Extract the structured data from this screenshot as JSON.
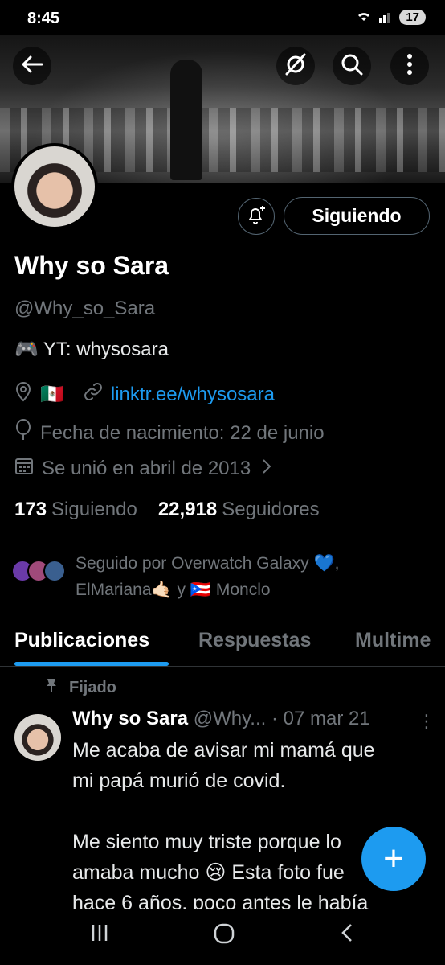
{
  "status": {
    "time": "8:45",
    "battery": "17"
  },
  "profile": {
    "follow_label": "Siguiendo",
    "name": "Why so Sara",
    "handle": "@Why_so_Sara",
    "bio_emoji": "🎮",
    "bio": "YT: whysosara",
    "flag": "🇲🇽",
    "link": "linktr.ee/whysosara",
    "birthday": "Fecha de nacimiento: 22 de junio",
    "joined": "Se unió en abril de 2013"
  },
  "stats": {
    "following_count": "173",
    "following_label": "Siguiendo",
    "followers_count": "22,918",
    "followers_label": "Seguidores"
  },
  "followed_by": {
    "line1": "Seguido por Overwatch Galaxy 💙,",
    "line2": "ElMariana🤙🏻 y 🇵🇷 Monclo"
  },
  "tabs": [
    {
      "label": "Publicaciones"
    },
    {
      "label": "Respuestas"
    },
    {
      "label": "Multime"
    }
  ],
  "pinned_label": "Fijado",
  "post": {
    "author": "Why so Sara",
    "handle": "@Why...",
    "date": "· 07 mar 21",
    "more": "⋮",
    "text": "Me acaba de avisar mi mamá que\nmi papá murió de covid.\n\nMe siento muy triste porque lo\namaba mucho 😢 Esta foto fue\nhace 6 años, poco antes le había"
  },
  "fab_label": "+",
  "colors": {
    "accent": "#1d9bf0",
    "background": "#000000",
    "muted": "#71767b"
  }
}
